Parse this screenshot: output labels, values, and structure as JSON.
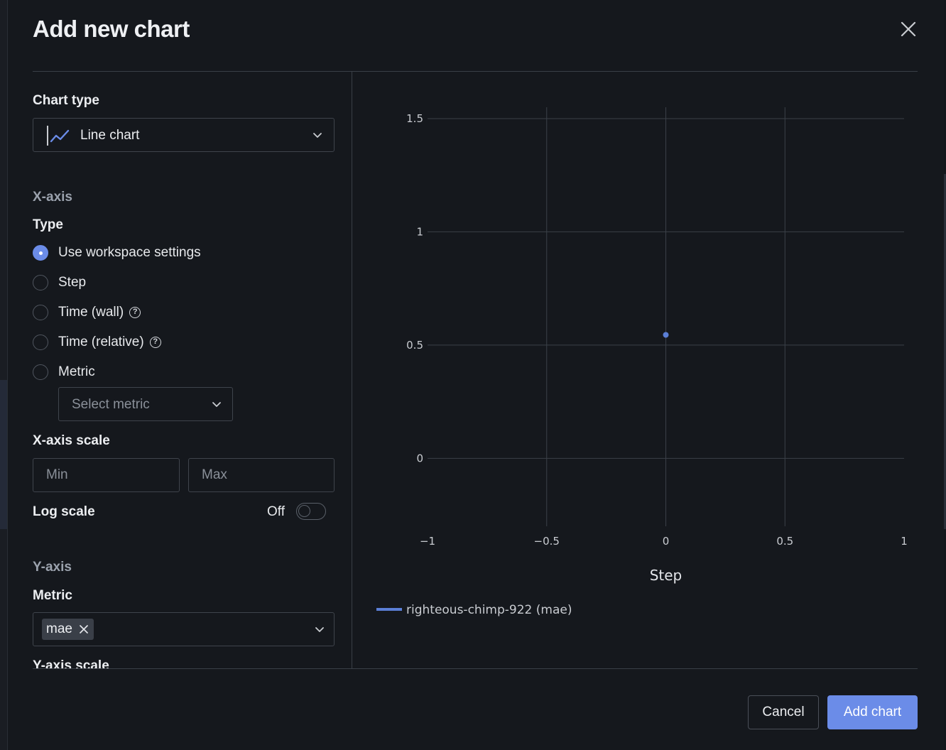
{
  "dialog": {
    "title": "Add new chart",
    "close_icon": "close-icon"
  },
  "chart_type": {
    "label": "Chart type",
    "value": "Line chart",
    "icon": "line-chart-icon"
  },
  "x_axis": {
    "section": "X-axis",
    "type_label": "Type",
    "options": [
      {
        "label": "Use workspace settings",
        "selected": true
      },
      {
        "label": "Step",
        "selected": false
      },
      {
        "label": "Time (wall)",
        "selected": false,
        "help": true
      },
      {
        "label": "Time (relative)",
        "selected": false,
        "help": true
      },
      {
        "label": "Metric",
        "selected": false
      }
    ],
    "metric_select_placeholder": "Select metric",
    "scale_label": "X-axis scale",
    "min_placeholder": "Min",
    "max_placeholder": "Max",
    "log_scale_label": "Log scale",
    "log_scale_state": "Off"
  },
  "y_axis": {
    "section": "Y-axis",
    "metric_label": "Metric",
    "selected_metrics": [
      "mae"
    ],
    "scale_label": "Y-axis scale"
  },
  "footer": {
    "cancel_label": "Cancel",
    "add_label": "Add chart"
  },
  "colors": {
    "accent": "#6b8ce8",
    "background": "#15181d",
    "series": "#5b7fd6"
  },
  "chart_data": {
    "type": "line",
    "xlabel": "Step",
    "ylabel": "",
    "xlim": [
      -1,
      1
    ],
    "ylim": [
      -0.3,
      1.55
    ],
    "x_ticks": [
      -1,
      -0.5,
      0,
      0.5,
      1
    ],
    "x_tick_labels": [
      "−1",
      "−0.5",
      "0",
      "0.5",
      "1"
    ],
    "y_ticks": [
      0,
      0.5,
      1,
      1.5
    ],
    "y_tick_labels": [
      "0",
      "0.5",
      "1",
      "1.5"
    ],
    "grid": true,
    "legend_position": "bottom-left",
    "series": [
      {
        "name": "righteous-chimp-922 (mae)",
        "x": [
          0
        ],
        "y": [
          0.545
        ]
      }
    ]
  }
}
